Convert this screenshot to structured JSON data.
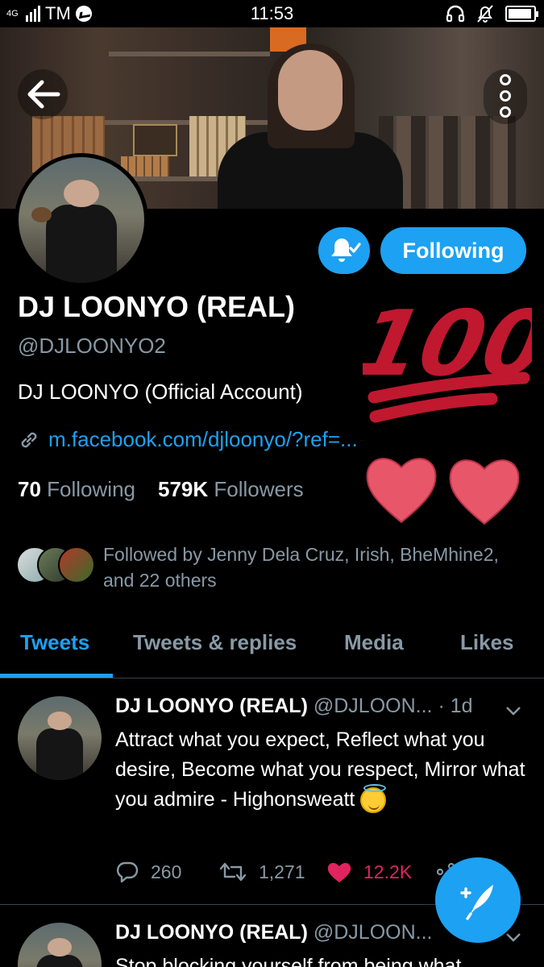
{
  "status_bar": {
    "network": "4G",
    "carrier": "TM",
    "time": "11:53"
  },
  "profile": {
    "display_name": "DJ LOONYO (REAL)",
    "handle": "@DJLOONYO2",
    "bio": "DJ LOONYO (Official Account)",
    "link": "m.facebook.com/djloonyo/?ref=...",
    "following_count": "70",
    "following_label": "Following",
    "followers_count": "579K",
    "followers_label": "Followers",
    "followed_by_line1": "Followed by Jenny Dela Cruz, Irish, BheMhine2,",
    "followed_by_line2": "and 22 others",
    "follow_button_label": "Following"
  },
  "sticker": {
    "number": "100"
  },
  "tabs": [
    {
      "label": "Tweets",
      "active": true
    },
    {
      "label": "Tweets & replies",
      "active": false
    },
    {
      "label": "Media",
      "active": false
    },
    {
      "label": "Likes",
      "active": false
    }
  ],
  "tweets": [
    {
      "name": "DJ LOONYO (REAL)",
      "handle": "@DJLOON...",
      "time": "· 1d",
      "text": "Attract what you expect, Reflect what you desire, Become what you respect, Mirror what you admire - Highonsweatt",
      "replies": "260",
      "retweets": "1,271",
      "likes": "12.2K"
    },
    {
      "name": "DJ LOONYO (REAL)",
      "handle": "@DJLOON...",
      "text": "Stop blocking yourself from being what"
    }
  ],
  "colors": {
    "accent": "#1da1f2",
    "muted": "#8899a6",
    "like": "#e0245e",
    "sticker_red": "#c0182f",
    "heart_pink": "#e8566a"
  },
  "icons": [
    "back-arrow-icon",
    "more-vertical-icon",
    "bell-check-icon",
    "link-icon",
    "reply-icon",
    "retweet-icon",
    "heart-icon",
    "share-icon",
    "chevron-down-icon",
    "compose-icon",
    "messenger-icon",
    "headset-icon",
    "bell-off-icon",
    "battery-icon"
  ]
}
